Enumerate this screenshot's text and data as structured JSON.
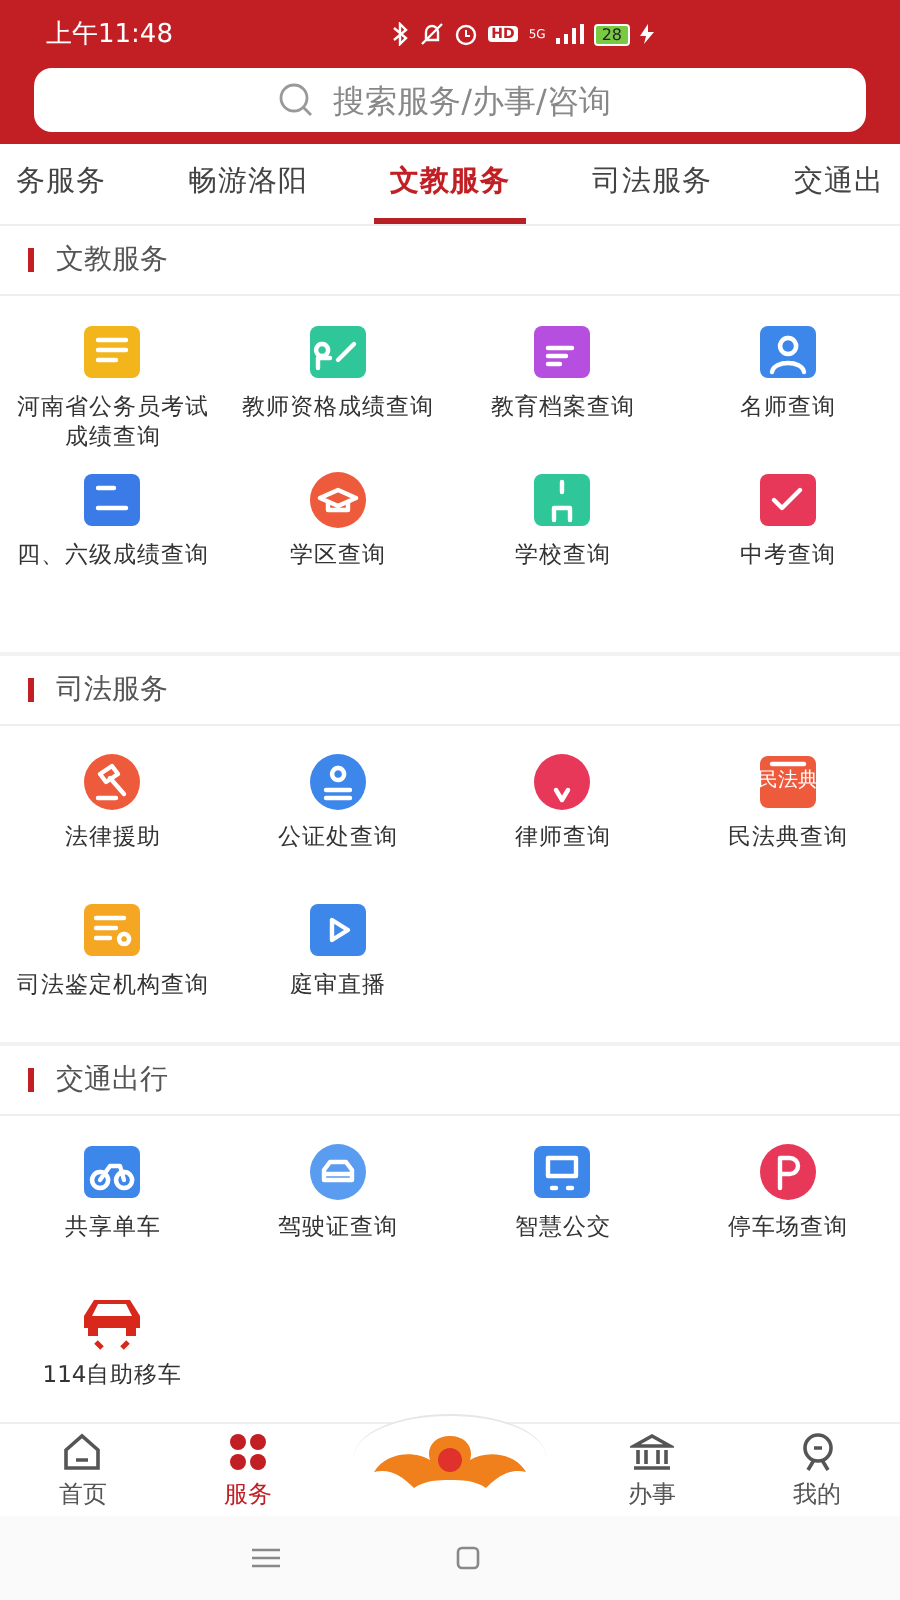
{
  "status_bar": {
    "time": "上午11:48",
    "hd": "HD",
    "network": "5G",
    "battery": "28"
  },
  "search": {
    "placeholder": "搜索服务/办事/咨询"
  },
  "tabs": [
    {
      "label": "务服务",
      "selected": false
    },
    {
      "label": "畅游洛阳",
      "selected": false
    },
    {
      "label": "文教服务",
      "selected": true
    },
    {
      "label": "司法服务",
      "selected": false
    },
    {
      "label": "交通出",
      "selected": false
    }
  ],
  "sections": [
    {
      "title": "文教服务",
      "items": [
        {
          "label": "河南省公务员考试成绩查询"
        },
        {
          "label": "教师资格成绩查询"
        },
        {
          "label": "教育档案查询"
        },
        {
          "label": "名师查询"
        },
        {
          "label": "四、六级成绩查询"
        },
        {
          "label": "学区查询"
        },
        {
          "label": "学校查询"
        },
        {
          "label": "中考查询"
        }
      ]
    },
    {
      "title": "司法服务",
      "items": [
        {
          "label": "法律援助"
        },
        {
          "label": "公证处查询"
        },
        {
          "label": "律师查询"
        },
        {
          "label": "民法典查询",
          "badge": "民法典"
        },
        {
          "label": "司法鉴定机构查询"
        },
        {
          "label": "庭审直播"
        }
      ]
    },
    {
      "title": "交通出行",
      "items": [
        {
          "label": "共享单车"
        },
        {
          "label": "驾驶证查询"
        },
        {
          "label": "智慧公交"
        },
        {
          "label": "停车场查询"
        },
        {
          "label": "114自助移车"
        }
      ]
    }
  ],
  "bottom_nav": [
    {
      "label": "首页",
      "selected": false
    },
    {
      "label": "服务",
      "selected": true
    },
    {
      "label": "办事",
      "selected": false
    },
    {
      "label": "我的",
      "selected": false
    }
  ]
}
